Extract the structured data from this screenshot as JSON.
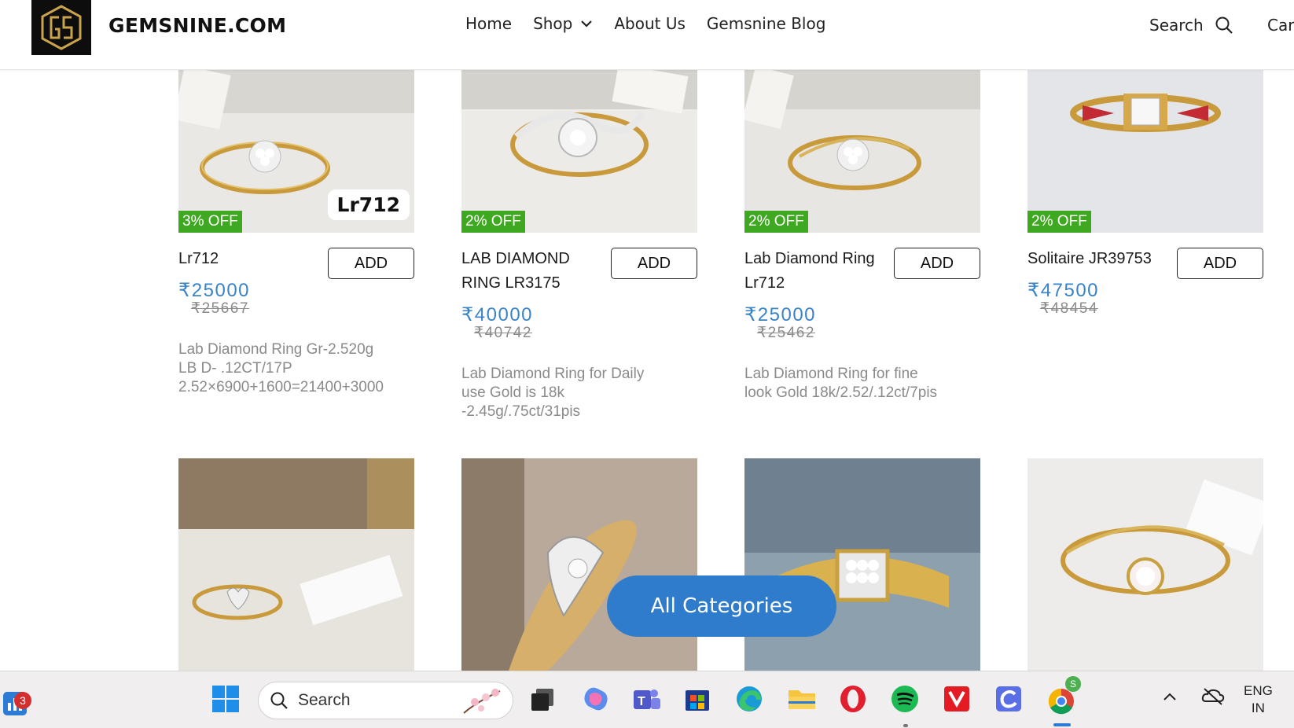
{
  "header": {
    "brand": "GEMSNINE.COM",
    "nav": [
      "Home",
      "Shop",
      "About Us",
      "Gemsnine Blog"
    ],
    "search_label": "Search",
    "cart_label": "Car"
  },
  "products_row1": [
    {
      "discount": "3% OFF",
      "tag": "Lr712",
      "name": "Lr712",
      "add": "ADD",
      "price": "₹25000",
      "old_price": "₹25667",
      "desc": "Lab Diamond Ring Gr-2.520g\nLB D- .12CT/17P\n2.52×6900+1600=21400+3000"
    },
    {
      "discount": "2% OFF",
      "name": "LAB DIAMOND RING LR3175",
      "add": "ADD",
      "price": "₹40000",
      "old_price": "₹40742",
      "desc": "Lab Diamond Ring for Daily\nuse Gold is 18k\n-2.45g/.75ct/31pis"
    },
    {
      "discount": "2% OFF",
      "name": "Lab Diamond Ring Lr712",
      "add": "ADD",
      "price": "₹25000",
      "old_price": "₹25462",
      "desc": "Lab Diamond Ring for fine\nlook Gold 18k/2.52/.12ct/7pis"
    },
    {
      "discount": "2% OFF",
      "name": "Solitaire JR39753",
      "add": "ADD",
      "price": "₹47500",
      "old_price": "₹48454",
      "desc": ""
    }
  ],
  "floating_button": "All Categories",
  "taskbar": {
    "widgets_badge": "3",
    "search_placeholder": "Search",
    "chrome_badge": "S",
    "lang_line1": "ENG",
    "lang_line2": "IN"
  },
  "colors": {
    "price_blue": "#3a83c8",
    "discount_green": "#3fa821",
    "cta_blue": "#2f7ccc"
  }
}
